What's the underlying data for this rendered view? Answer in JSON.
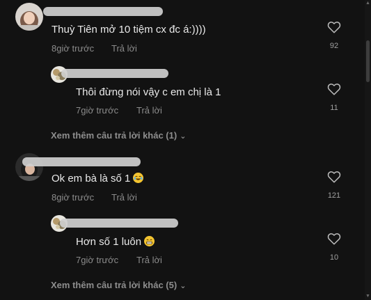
{
  "colors": {
    "background": "#121212",
    "text": "#eaeaea",
    "muted": "#8b8b8b",
    "username_blur": "#cfcfcf"
  },
  "comments": [
    {
      "text": "Thuỳ Tiên mở 10 tiệm cx đc á:))))",
      "time": "8giờ trước",
      "reply_label": "Trả lời",
      "likes": "92"
    },
    {
      "text": "Thôi đừng nói vậy c em chị là 1",
      "time": "7giờ trước",
      "reply_label": "Trả lời",
      "likes": "11"
    },
    {
      "text": "Ok em bà là số 1",
      "time": "8giờ trước",
      "reply_label": "Trả lời",
      "likes": "121",
      "emoji": "joy"
    },
    {
      "text": "Hơn số 1 luôn",
      "time": "7giờ trước",
      "reply_label": "Trả lời",
      "likes": "10",
      "emoji": "grin"
    }
  ],
  "more_replies": [
    {
      "label": "Xem thêm câu trả lời khác (1)",
      "icon": "chevron-down-icon"
    },
    {
      "label": "Xem thêm câu trả lời khác (5)",
      "icon": "chevron-down-icon"
    }
  ]
}
